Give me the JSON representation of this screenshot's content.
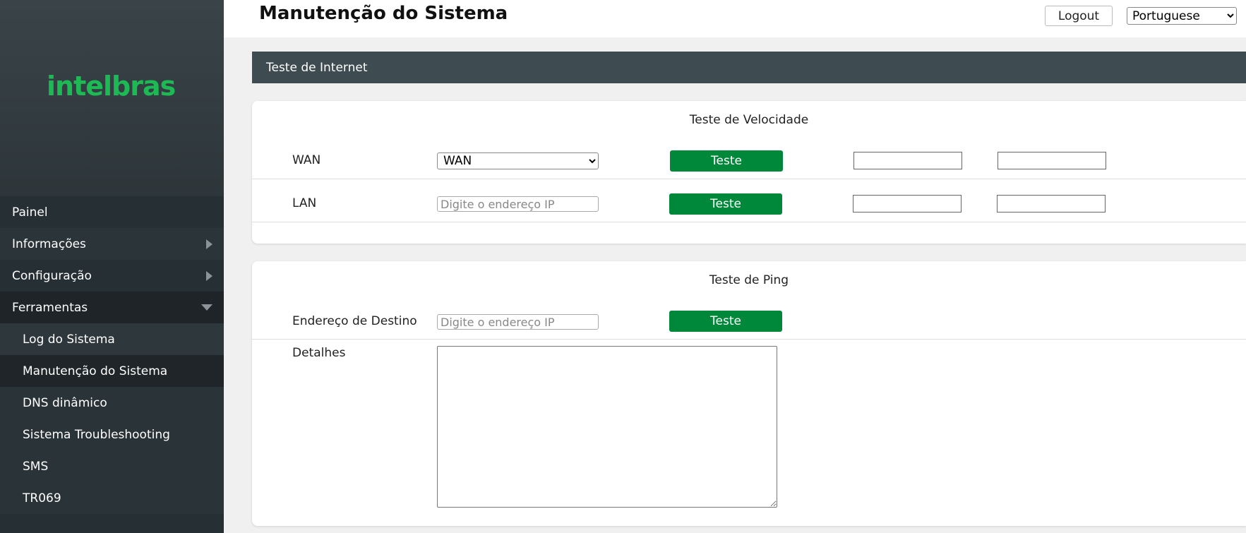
{
  "sidebar": {
    "logo": "intelbras",
    "menu": [
      {
        "label": "Painel"
      },
      {
        "label": "Informações"
      },
      {
        "label": "Configuração"
      },
      {
        "label": "Ferramentas"
      }
    ],
    "submenu": [
      {
        "label": "Log do Sistema"
      },
      {
        "label": "Manutenção do Sistema"
      },
      {
        "label": "DNS dinâmico"
      },
      {
        "label": "Sistema Troubleshooting"
      },
      {
        "label": "SMS"
      },
      {
        "label": "TR069"
      }
    ],
    "active_item": "Manutenção do Sistema"
  },
  "header": {
    "title": "Manutenção do Sistema",
    "logout_label": "Logout",
    "language": "Portuguese"
  },
  "section": {
    "title": "Teste de Internet"
  },
  "speed_test": {
    "title": "Teste de Velocidade",
    "wan_label": "WAN",
    "wan_selected": "WAN",
    "wan_button": "Teste",
    "lan_label": "LAN",
    "lan_placeholder": "Digite o endereço IP",
    "lan_button": "Teste"
  },
  "ping_test": {
    "title": "Teste de Ping",
    "dest_label": "Endereço de Destino",
    "dest_placeholder": "Digite o endereço IP",
    "button": "Teste",
    "details_label": "Detalhes"
  },
  "colors": {
    "accent_green": "#00883a",
    "logo_green": "#1db954",
    "section_bar": "#3e4b51",
    "sidebar_bg": "#263034"
  }
}
